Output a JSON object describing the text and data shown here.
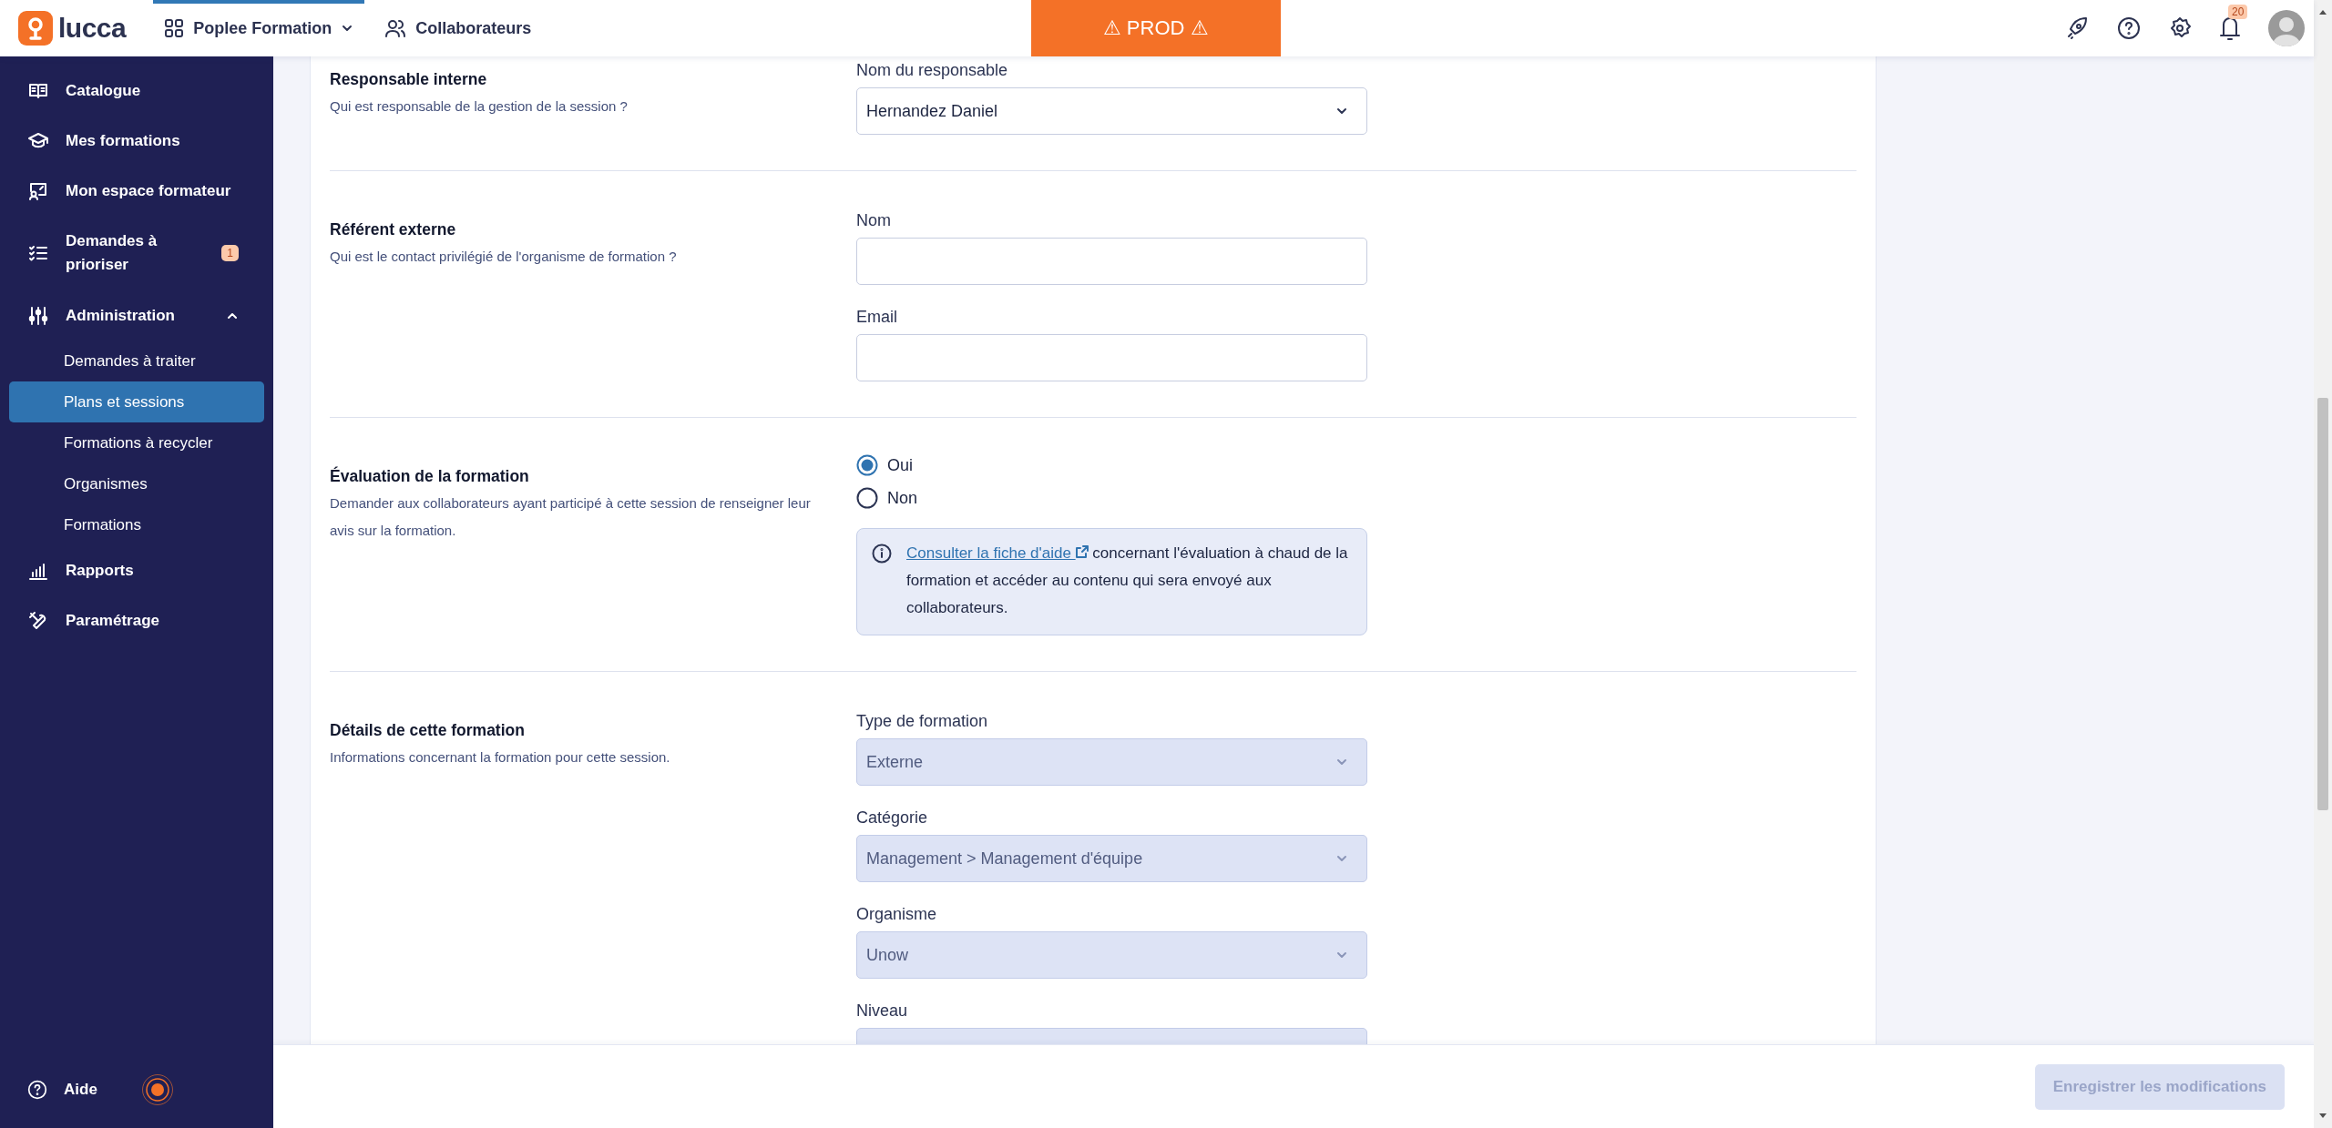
{
  "topbar": {
    "logo": "lucca",
    "app_switcher": {
      "label": "Poplee Formation",
      "selected": true
    },
    "nav_link": {
      "label": "Collaborateurs",
      "selected": false
    },
    "environment_banner": "⚠ PROD ⚠",
    "notifications_count": "20"
  },
  "sidebar": {
    "items": [
      {
        "label": "Catalogue",
        "selected": false
      },
      {
        "label": "Mes formations",
        "selected": false
      },
      {
        "label": "Mon espace formateur",
        "selected": false
      },
      {
        "label": "Demandes à prioriser",
        "badge": "1",
        "selected": false
      },
      {
        "label": "Administration",
        "selected": false,
        "expanded": true,
        "children": [
          {
            "label": "Demandes à traiter",
            "selected": false
          },
          {
            "label": "Plans et sessions",
            "selected": true
          },
          {
            "label": "Formations à recycler",
            "selected": false
          },
          {
            "label": "Organismes",
            "selected": false
          },
          {
            "label": "Formations",
            "selected": false
          }
        ]
      },
      {
        "label": "Rapports",
        "selected": false
      },
      {
        "label": "Paramétrage",
        "selected": false
      }
    ],
    "help": "Aide"
  },
  "sections": [
    {
      "title": "Responsable interne",
      "description": "Qui est responsable de la gestion de la session ?",
      "fields": [
        {
          "kind": "select",
          "label": "Nom du responsable",
          "value": "Hernandez Daniel",
          "disabled": false
        }
      ]
    },
    {
      "title": "Référent externe",
      "description": "Qui est le contact privilégié de l'organisme de formation ?",
      "fields": [
        {
          "kind": "text_input",
          "label": "Nom"
        },
        {
          "kind": "text_input",
          "label": "Email"
        }
      ]
    },
    {
      "title": "Évaluation de la formation",
      "description": "Demander aux collaborateurs ayant participé à cette session de renseigner leur avis sur la formation.",
      "fields": [
        {
          "kind": "radio_group",
          "options": [
            {
              "label": "Oui",
              "selected": true
            },
            {
              "label": "Non",
              "selected": false
            }
          ]
        },
        {
          "kind": "info",
          "link": "Consulter la fiche d'aide",
          "text": " concernant l'évaluation à chaud de la formation et accéder au contenu qui sera envoyé aux collaborateurs."
        }
      ]
    },
    {
      "title": "Détails de cette formation",
      "description": "Informations concernant la formation pour cette session.",
      "fields": [
        {
          "kind": "select",
          "label": "Type de formation",
          "value": "Externe",
          "disabled": true
        },
        {
          "kind": "select",
          "label": "Catégorie",
          "value": "Management > Management d'équipe",
          "disabled": true
        },
        {
          "kind": "select",
          "label": "Organisme",
          "value": "Unow",
          "disabled": true
        },
        {
          "kind": "select",
          "label": "Niveau",
          "disabled": true
        }
      ]
    }
  ],
  "footer": {
    "save_button": {
      "label": "Enregistrer les modifications",
      "disabled": true
    }
  }
}
